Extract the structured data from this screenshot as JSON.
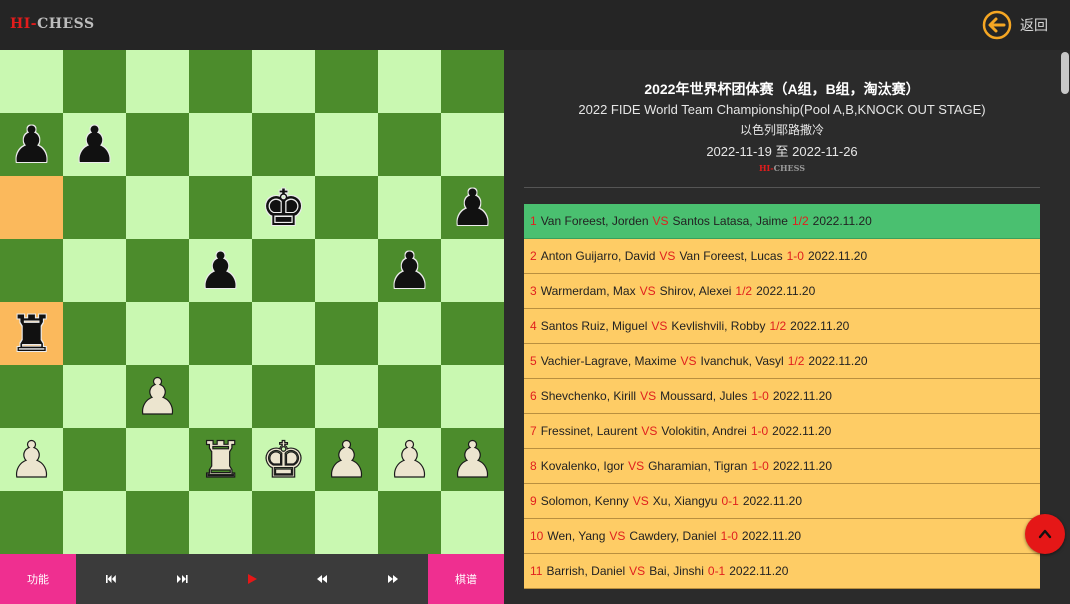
{
  "header": {
    "logo_hi": "HI-",
    "logo_chess": "CHESS",
    "back_label": "返回"
  },
  "board": {
    "ranks": [
      [
        "",
        "",
        "",
        "",
        "",
        "",
        "",
        ""
      ],
      [
        "bp",
        "bp",
        "",
        "",
        "",
        "",
        "",
        ""
      ],
      [
        "",
        "",
        "",
        "",
        "bk",
        "",
        "",
        "bp"
      ],
      [
        "",
        "",
        "",
        "bp",
        "",
        "",
        "bp",
        ""
      ],
      [
        "br",
        "",
        "",
        "",
        "",
        "",
        "",
        ""
      ],
      [
        "",
        "",
        "wp",
        "",
        "",
        "",
        "",
        ""
      ],
      [
        "wp",
        "",
        "",
        "wr",
        "wk",
        "wp",
        "wp",
        "wp"
      ],
      [
        "",
        "",
        "",
        "",
        "",
        "",
        "",
        ""
      ]
    ],
    "highlighted": [
      "a6",
      "a4"
    ],
    "colors": {
      "light": "#c9f8b1",
      "dark": "#4c8c2c",
      "highlight": "#fbb95c"
    }
  },
  "controls": {
    "function_label": "功能",
    "moves_label": "棋谱",
    "icons": [
      "first-icon",
      "prev-icon",
      "play-icon",
      "back-icon",
      "forward-icon"
    ]
  },
  "event": {
    "title_zh": "2022年世界杯团体赛（A组，B组，淘汰赛）",
    "title_en": "2022 FIDE World Team Championship(Pool A,B,KNOCK OUT STAGE)",
    "subtitle": "以色列耶路撒冷",
    "date_start": "2022-11-19",
    "date_sep": "至",
    "date_end": "2022-11-26",
    "logo_hi": "HI-",
    "logo_chess": "CHESS"
  },
  "games": [
    {
      "no": "1",
      "white": "Van Foreest, Jorden",
      "vs": "VS",
      "black": "Santos Latasa, Jaime",
      "result": "1/2",
      "date": "2022.11.20"
    },
    {
      "no": "2",
      "white": "Anton Guijarro, David",
      "vs": "VS",
      "black": "Van Foreest, Lucas",
      "result": "1-0",
      "date": "2022.11.20"
    },
    {
      "no": "3",
      "white": "Warmerdam, Max",
      "vs": "VS",
      "black": "Shirov, Alexei",
      "result": "1/2",
      "date": "2022.11.20"
    },
    {
      "no": "4",
      "white": "Santos Ruiz, Miguel",
      "vs": "VS",
      "black": "Kevlishvili, Robby",
      "result": "1/2",
      "date": "2022.11.20"
    },
    {
      "no": "5",
      "white": "Vachier-Lagrave, Maxime",
      "vs": "VS",
      "black": "Ivanchuk, Vasyl",
      "result": "1/2",
      "date": "2022.11.20"
    },
    {
      "no": "6",
      "white": "Shevchenko, Kirill",
      "vs": "VS",
      "black": "Moussard, Jules",
      "result": "1-0",
      "date": "2022.11.20"
    },
    {
      "no": "7",
      "white": "Fressinet, Laurent",
      "vs": "VS",
      "black": "Volokitin, Andrei",
      "result": "1-0",
      "date": "2022.11.20"
    },
    {
      "no": "8",
      "white": "Kovalenko, Igor",
      "vs": "VS",
      "black": "Gharamian, Tigran",
      "result": "1-0",
      "date": "2022.11.20"
    },
    {
      "no": "9",
      "white": "Solomon, Kenny",
      "vs": "VS",
      "black": "Xu, Xiangyu",
      "result": "0-1",
      "date": "2022.11.20"
    },
    {
      "no": "10",
      "white": "Wen, Yang",
      "vs": "VS",
      "black": "Cawdery, Daniel",
      "result": "1-0",
      "date": "2022.11.20"
    },
    {
      "no": "11",
      "white": "Barrish, Daniel",
      "vs": "VS",
      "black": "Bai, Jinshi",
      "result": "0-1",
      "date": "2022.11.20"
    }
  ],
  "active_game": 0,
  "accent": {
    "red": "#e0201e",
    "pink": "#ef2f90",
    "active_row": "#4ac070",
    "row": "#fecc65",
    "back_icon": "#f5a623"
  }
}
